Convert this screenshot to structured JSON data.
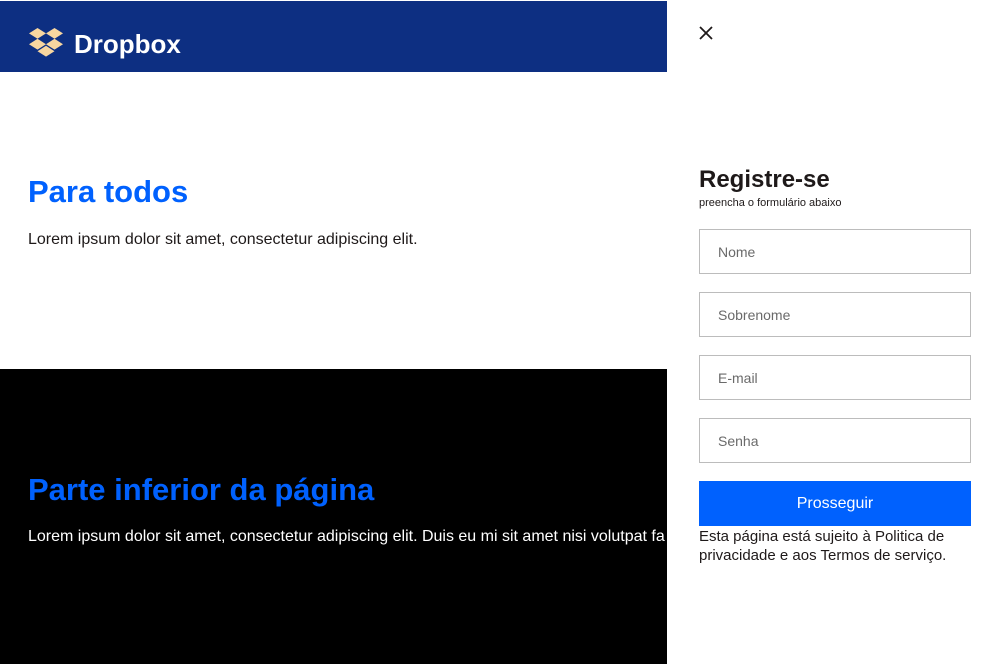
{
  "header": {
    "brand": "Dropbox",
    "logo_icon": "dropbox-logo-icon",
    "background_color": "#0d2f82",
    "logo_color": "#f7d6a0"
  },
  "sections": [
    {
      "heading": "Para todos",
      "text": "Lorem ipsum dolor sit amet, consectetur adipiscing elit."
    },
    {
      "heading": "Parte inferior da página",
      "text": "Lorem ipsum dolor sit amet, consectetur adipiscing elit. Duis eu mi sit amet nisi volutpat fa"
    }
  ],
  "signup": {
    "close_icon": "close-icon",
    "title": "Registre-se",
    "subtitle": "preencha o formulário abaixo",
    "fields": {
      "first_name": {
        "value": "",
        "placeholder": "Nome"
      },
      "last_name": {
        "value": "",
        "placeholder": "Sobrenome"
      },
      "email": {
        "value": "",
        "placeholder": "E-mail"
      },
      "password": {
        "value": "",
        "placeholder": "Senha"
      }
    },
    "submit_label": "Prosseguir",
    "legal_text": "Esta página está sujeito à Politica de privacidade e aos Termos de serviço."
  },
  "colors": {
    "accent": "#0061fe",
    "dark_section": "#000000"
  }
}
